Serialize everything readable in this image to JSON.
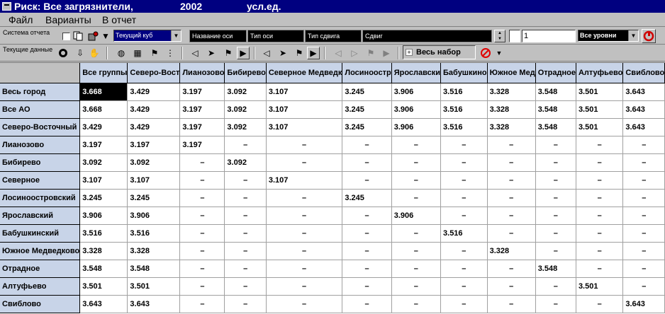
{
  "window": {
    "title_app": "Риск: Все загрязнители,",
    "title_year": "2002",
    "title_unit": "усл.ед."
  },
  "menu": {
    "items": [
      {
        "label": "Файл"
      },
      {
        "label": "Варианты"
      },
      {
        "label": "В отчет"
      }
    ]
  },
  "toolbar1": {
    "report_system_label": "Система отчета",
    "cube_select": "Текущий куб",
    "axis_name": "Название оси",
    "axis_type": "Тип оси",
    "shift_type": "Тип сдвига",
    "shift": "Сдвиг",
    "shift_value": "1",
    "levels_select": "Все уровни"
  },
  "toolbar2": {
    "current_data_label": "Текущие данные",
    "set_label": "Весь набор"
  },
  "grid": {
    "columns": [
      "Все группы",
      "Северо-Вост",
      "Лианозово",
      "Бибирево",
      "Северное Медведк",
      "Лосиноостр",
      "Ярославски",
      "Бабушкино",
      "Южное Мед",
      "Отрадное",
      "Алтуфьево",
      "Свиблово"
    ],
    "rows": [
      {
        "label": "Весь город",
        "values": [
          "3.668",
          "3.429",
          "3.197",
          "3.092",
          "3.107",
          "3.245",
          "3.906",
          "3.516",
          "3.328",
          "3.548",
          "3.501",
          "3.643"
        ]
      },
      {
        "label": "Все АО",
        "values": [
          "3.668",
          "3.429",
          "3.197",
          "3.092",
          "3.107",
          "3.245",
          "3.906",
          "3.516",
          "3.328",
          "3.548",
          "3.501",
          "3.643"
        ]
      },
      {
        "label": "Северо-Восточный",
        "values": [
          "3.429",
          "3.429",
          "3.197",
          "3.092",
          "3.107",
          "3.245",
          "3.906",
          "3.516",
          "3.328",
          "3.548",
          "3.501",
          "3.643"
        ]
      },
      {
        "label": "Лианозово",
        "values": [
          "3.197",
          "3.197",
          "3.197",
          "–",
          "–",
          "–",
          "–",
          "–",
          "–",
          "–",
          "–",
          "–"
        ]
      },
      {
        "label": "Бибирево",
        "values": [
          "3.092",
          "3.092",
          "–",
          "3.092",
          "–",
          "–",
          "–",
          "–",
          "–",
          "–",
          "–",
          "–"
        ]
      },
      {
        "label": "Северное",
        "values": [
          "3.107",
          "3.107",
          "–",
          "–",
          "3.107",
          "–",
          "–",
          "–",
          "–",
          "–",
          "–",
          "–"
        ]
      },
      {
        "label": "Лосиноостровский",
        "values": [
          "3.245",
          "3.245",
          "–",
          "–",
          "–",
          "3.245",
          "–",
          "–",
          "–",
          "–",
          "–",
          "–"
        ]
      },
      {
        "label": "Ярославский",
        "values": [
          "3.906",
          "3.906",
          "–",
          "–",
          "–",
          "–",
          "3.906",
          "–",
          "–",
          "–",
          "–",
          "–"
        ]
      },
      {
        "label": "Бабушкинский",
        "values": [
          "3.516",
          "3.516",
          "–",
          "–",
          "–",
          "–",
          "–",
          "3.516",
          "–",
          "–",
          "–",
          "–"
        ]
      },
      {
        "label": "Южное Медведково",
        "values": [
          "3.328",
          "3.328",
          "–",
          "–",
          "–",
          "–",
          "–",
          "–",
          "3.328",
          "–",
          "–",
          "–"
        ]
      },
      {
        "label": "Отрадное",
        "values": [
          "3.548",
          "3.548",
          "–",
          "–",
          "–",
          "–",
          "–",
          "–",
          "–",
          "3.548",
          "–",
          "–"
        ]
      },
      {
        "label": "Алтуфьево",
        "values": [
          "3.501",
          "3.501",
          "–",
          "–",
          "–",
          "–",
          "–",
          "–",
          "–",
          "–",
          "3.501",
          "–"
        ]
      },
      {
        "label": "Свиблово",
        "values": [
          "3.643",
          "3.643",
          "–",
          "–",
          "–",
          "–",
          "–",
          "–",
          "–",
          "–",
          "–",
          "3.643"
        ]
      }
    ]
  }
}
